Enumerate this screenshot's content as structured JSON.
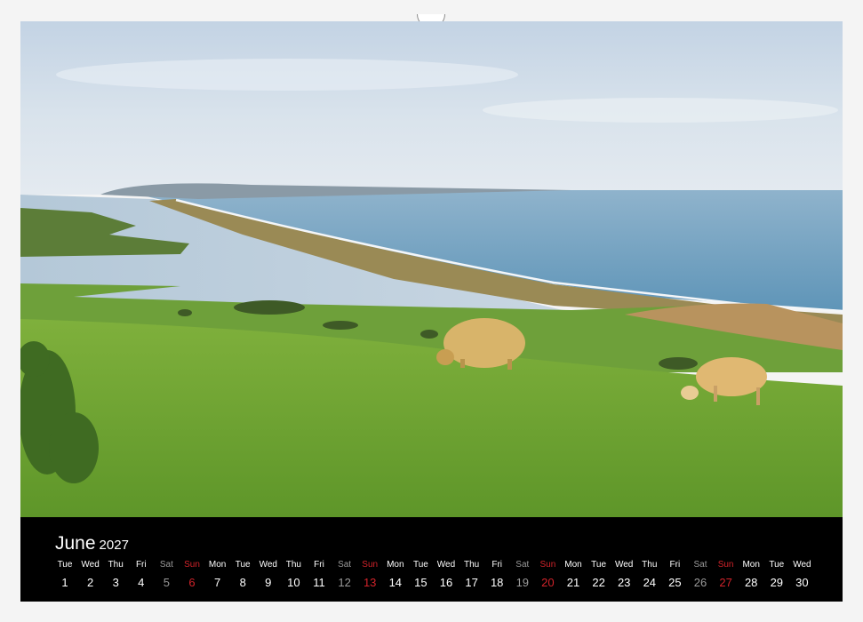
{
  "calendar": {
    "month": "June",
    "year": "2027",
    "days": [
      {
        "wd": "Tue",
        "d": "1",
        "kind": "weekday"
      },
      {
        "wd": "Wed",
        "d": "2",
        "kind": "weekday"
      },
      {
        "wd": "Thu",
        "d": "3",
        "kind": "weekday"
      },
      {
        "wd": "Fri",
        "d": "4",
        "kind": "weekday"
      },
      {
        "wd": "Sat",
        "d": "5",
        "kind": "sat"
      },
      {
        "wd": "Sun",
        "d": "6",
        "kind": "sun"
      },
      {
        "wd": "Mon",
        "d": "7",
        "kind": "weekday"
      },
      {
        "wd": "Tue",
        "d": "8",
        "kind": "weekday"
      },
      {
        "wd": "Wed",
        "d": "9",
        "kind": "weekday"
      },
      {
        "wd": "Thu",
        "d": "10",
        "kind": "weekday"
      },
      {
        "wd": "Fri",
        "d": "11",
        "kind": "weekday"
      },
      {
        "wd": "Sat",
        "d": "12",
        "kind": "sat"
      },
      {
        "wd": "Sun",
        "d": "13",
        "kind": "sun"
      },
      {
        "wd": "Mon",
        "d": "14",
        "kind": "weekday"
      },
      {
        "wd": "Tue",
        "d": "15",
        "kind": "weekday"
      },
      {
        "wd": "Wed",
        "d": "16",
        "kind": "weekday"
      },
      {
        "wd": "Thu",
        "d": "17",
        "kind": "weekday"
      },
      {
        "wd": "Fri",
        "d": "18",
        "kind": "weekday"
      },
      {
        "wd": "Sat",
        "d": "19",
        "kind": "sat"
      },
      {
        "wd": "Sun",
        "d": "20",
        "kind": "sun"
      },
      {
        "wd": "Mon",
        "d": "21",
        "kind": "weekday"
      },
      {
        "wd": "Tue",
        "d": "22",
        "kind": "weekday"
      },
      {
        "wd": "Wed",
        "d": "23",
        "kind": "weekday"
      },
      {
        "wd": "Thu",
        "d": "24",
        "kind": "weekday"
      },
      {
        "wd": "Fri",
        "d": "25",
        "kind": "weekday"
      },
      {
        "wd": "Sat",
        "d": "26",
        "kind": "sat"
      },
      {
        "wd": "Sun",
        "d": "27",
        "kind": "sun"
      },
      {
        "wd": "Mon",
        "d": "28",
        "kind": "weekday"
      },
      {
        "wd": "Tue",
        "d": "29",
        "kind": "weekday"
      },
      {
        "wd": "Wed",
        "d": "30",
        "kind": "weekday"
      }
    ]
  },
  "colors": {
    "sunday": "#d1232a",
    "saturday": "#9a9a9a",
    "bar": "#000000"
  }
}
